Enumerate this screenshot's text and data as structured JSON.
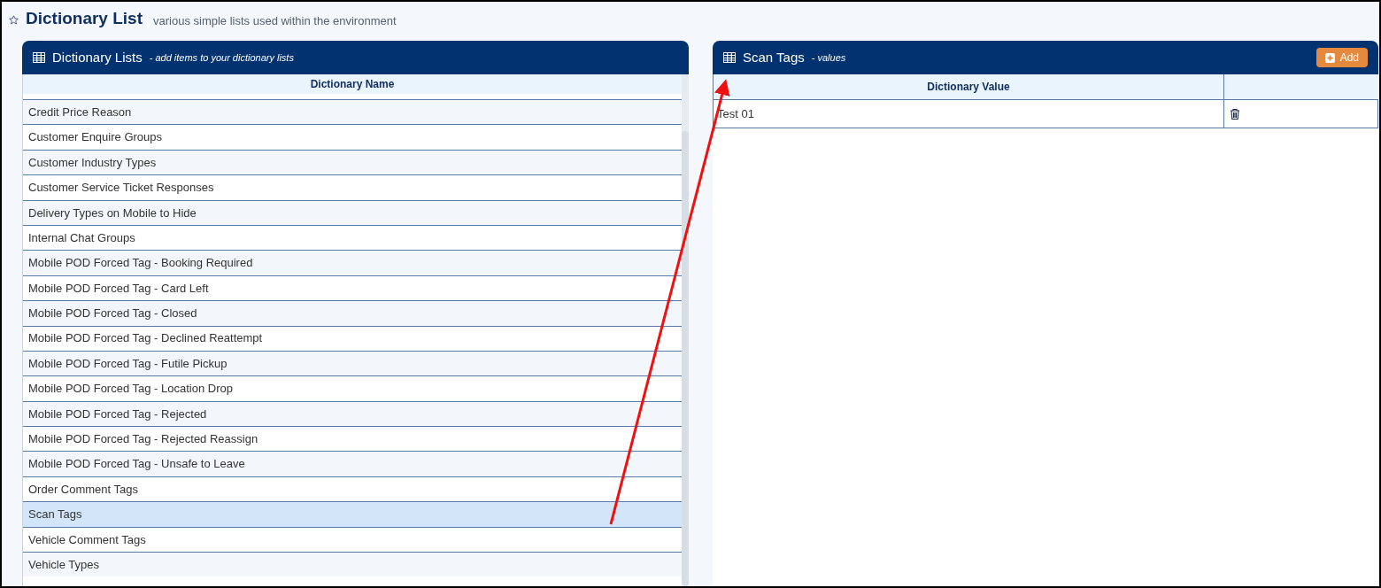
{
  "page": {
    "title": "Dictionary List",
    "subtitle": "various simple lists used within the environment"
  },
  "lists_panel": {
    "title": "Dictionary Lists",
    "subtitle": "- add items to your dictionary lists",
    "column": "Dictionary Name",
    "rows": [
      {
        "name": "Credit Price Reason",
        "selected": false
      },
      {
        "name": "Customer Enquire Groups",
        "selected": false
      },
      {
        "name": "Customer Industry Types",
        "selected": false
      },
      {
        "name": "Customer Service Ticket Responses",
        "selected": false
      },
      {
        "name": "Delivery Types on Mobile to Hide",
        "selected": false
      },
      {
        "name": "Internal Chat Groups",
        "selected": false
      },
      {
        "name": "Mobile POD Forced Tag - Booking Required",
        "selected": false
      },
      {
        "name": "Mobile POD Forced Tag - Card Left",
        "selected": false
      },
      {
        "name": "Mobile POD Forced Tag - Closed",
        "selected": false
      },
      {
        "name": "Mobile POD Forced Tag - Declined Reattempt",
        "selected": false
      },
      {
        "name": "Mobile POD Forced Tag - Futile Pickup",
        "selected": false
      },
      {
        "name": "Mobile POD Forced Tag - Location Drop",
        "selected": false
      },
      {
        "name": "Mobile POD Forced Tag - Rejected",
        "selected": false
      },
      {
        "name": "Mobile POD Forced Tag - Rejected Reassign",
        "selected": false
      },
      {
        "name": "Mobile POD Forced Tag - Unsafe to Leave",
        "selected": false
      },
      {
        "name": "Order Comment Tags",
        "selected": false
      },
      {
        "name": "Scan Tags",
        "selected": true
      },
      {
        "name": "Vehicle Comment Tags",
        "selected": false
      },
      {
        "name": "Vehicle Types",
        "selected": false
      }
    ]
  },
  "values_panel": {
    "title": "Scan Tags",
    "subtitle": "- values",
    "add_button": "Add",
    "column": "Dictionary Value",
    "rows": [
      {
        "value": "Test 01"
      }
    ]
  }
}
